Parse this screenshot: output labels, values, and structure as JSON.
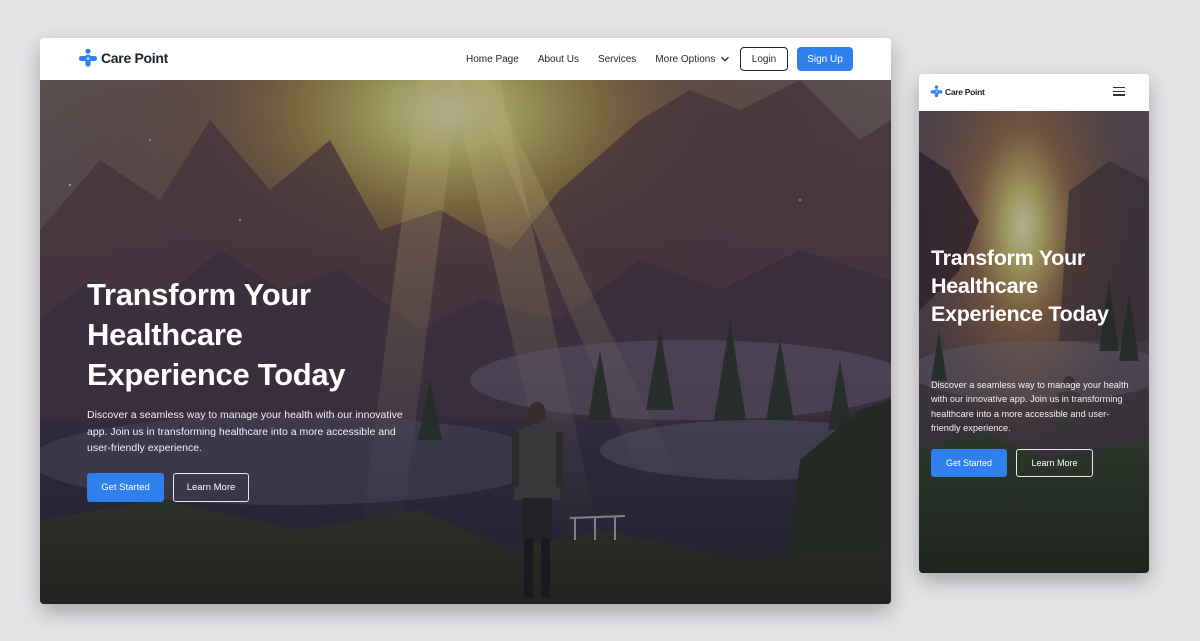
{
  "brand": {
    "name": "Care Point",
    "accent": "#2f80ed",
    "logo_icon": "medical-cross-icon"
  },
  "nav": {
    "items": [
      "Home Page",
      "About Us",
      "Services",
      "More Options"
    ],
    "more_icon": "chevron-down-icon",
    "login_label": "Login",
    "signup_label": "Sign Up",
    "mobile_menu_icon": "hamburger-menu-icon"
  },
  "hero": {
    "title_line1": "Transform Your",
    "title_line2": "Healthcare",
    "title_line3": "Experience Today",
    "description": "Discover a seamless way to manage your health with our innovative app. Join us in transforming healthcare into a more accessible and user-friendly experience.",
    "primary_label": "Get Started",
    "secondary_label": "Learn More",
    "background": "mountain-sunrise-hiker-image"
  }
}
